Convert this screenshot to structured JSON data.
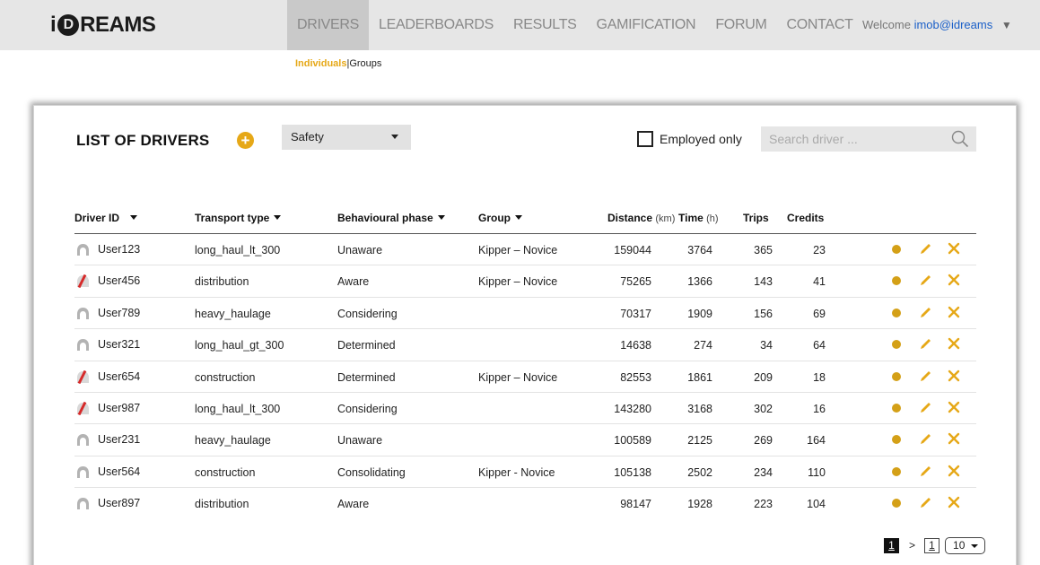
{
  "header": {
    "logo_i": "i",
    "logo_d": "D",
    "logo_rest": "REAMS",
    "nav": [
      {
        "label": "DRIVERS",
        "active": true
      },
      {
        "label": "LEADERBOARDS",
        "active": false
      },
      {
        "label": "RESULTS",
        "active": false
      },
      {
        "label": "GAMIFICATION",
        "active": false
      },
      {
        "label": "FORUM",
        "active": false
      },
      {
        "label": "CONTACT",
        "active": false
      }
    ],
    "welcome_prefix": "Welcome",
    "welcome_user": "imob@idreams",
    "welcome_caret": "▼"
  },
  "subnav": {
    "individuals": "Individuals",
    "separator": "|",
    "groups": "Groups"
  },
  "panel": {
    "title": "LIST OF DRIVERS",
    "add_symbol": "+",
    "filter_value": "Safety",
    "employed_label": "Employed only",
    "search_placeholder": "Search driver ..."
  },
  "table": {
    "headers": {
      "driver_id": "Driver ID",
      "transport": "Transport type",
      "phase": "Behavioural phase",
      "group": "Group",
      "distance": "Distance",
      "distance_unit": "(km)",
      "time": "Time",
      "time_unit": "(h)",
      "trips": "Trips",
      "credits": "Credits"
    },
    "rows": [
      {
        "id": "User123",
        "avatar": "grey",
        "transport": "long_haul_lt_300",
        "phase": "Unaware",
        "group": "Kipper – Novice",
        "distance": "159044",
        "time": "3764",
        "trips": "365",
        "credits": "23"
      },
      {
        "id": "User456",
        "avatar": "red",
        "transport": "distribution",
        "phase": "Aware",
        "group": "Kipper – Novice",
        "distance": "75265",
        "time": "1366",
        "trips": "143",
        "credits": "41"
      },
      {
        "id": "User789",
        "avatar": "grey",
        "transport": "heavy_haulage",
        "phase": "Considering",
        "group": "",
        "distance": "70317",
        "time": "1909",
        "trips": "156",
        "credits": "69"
      },
      {
        "id": "User321",
        "avatar": "grey",
        "transport": "long_haul_gt_300",
        "phase": "Determined",
        "group": "",
        "distance": "14638",
        "time": "274",
        "trips": "34",
        "credits": "64"
      },
      {
        "id": "User654",
        "avatar": "red",
        "transport": "construction",
        "phase": "Determined",
        "group": "Kipper – Novice",
        "distance": "82553",
        "time": "1861",
        "trips": "209",
        "credits": "18"
      },
      {
        "id": "User987",
        "avatar": "red",
        "transport": "long_haul_lt_300",
        "phase": "Considering",
        "group": "",
        "distance": "143280",
        "time": "3168",
        "trips": "302",
        "credits": "16"
      },
      {
        "id": "User231",
        "avatar": "grey",
        "transport": "heavy_haulage",
        "phase": "Unaware",
        "group": "",
        "distance": "100589",
        "time": "2125",
        "trips": "269",
        "credits": "164"
      },
      {
        "id": "User564",
        "avatar": "grey",
        "transport": "construction",
        "phase": "Consolidating",
        "group": "Kipper - Novice",
        "distance": "105138",
        "time": "2502",
        "trips": "234",
        "credits": "110"
      },
      {
        "id": "User897",
        "avatar": "grey",
        "transport": "distribution",
        "phase": "Aware",
        "group": "",
        "distance": "98147",
        "time": "1928",
        "trips": "223",
        "credits": "104"
      }
    ]
  },
  "pagination": {
    "current": "1",
    "next": ">",
    "last": "1",
    "page_size": "10"
  },
  "colors": {
    "accent": "#e6a817",
    "status_dot": "#d4a017",
    "avatar_grey": "#b3b3b3",
    "avatar_red": "#d62a2a",
    "link": "#1a5fc8"
  },
  "icons": {
    "add": "plus-circle-icon",
    "search": "magnifier-icon",
    "edit": "pencil-icon",
    "delete": "x-icon",
    "status": "dot-icon",
    "avatar": "user-avatar-icon"
  }
}
